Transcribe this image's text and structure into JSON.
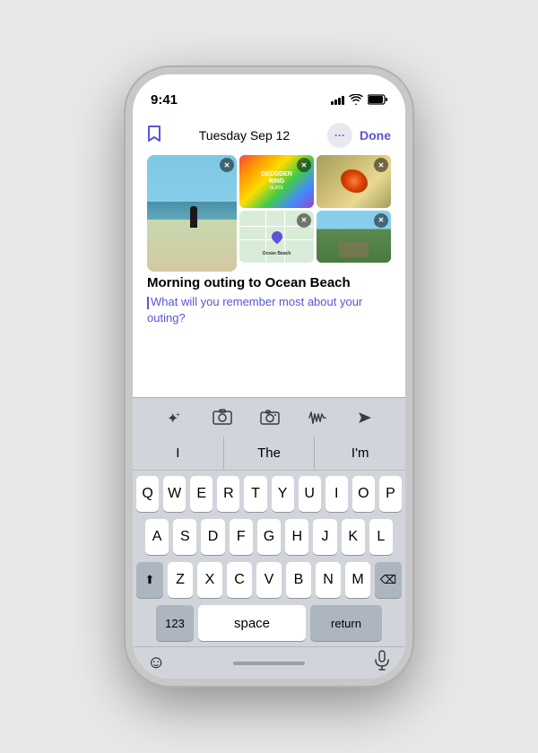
{
  "status": {
    "time": "9:41",
    "signal": [
      3,
      5,
      7,
      9,
      11
    ],
    "wifi": "WiFi",
    "battery": "Battery"
  },
  "header": {
    "date": "Tuesday Sep 12",
    "more_label": "···",
    "done_label": "Done"
  },
  "note": {
    "title": "Morning outing to Ocean Beach",
    "prompt": "What will you remember most about your outing?"
  },
  "toolbar": {
    "magic_label": "✦",
    "photo_label": "⊞",
    "camera_label": "⊙",
    "audio_label": "♒",
    "send_label": "➤"
  },
  "suggestions": {
    "items": [
      "I",
      "The",
      "I'm"
    ]
  },
  "keyboard": {
    "row1": [
      "Q",
      "W",
      "E",
      "R",
      "T",
      "Y",
      "U",
      "I",
      "O",
      "P"
    ],
    "row2": [
      "A",
      "S",
      "D",
      "F",
      "G",
      "H",
      "J",
      "K",
      "L"
    ],
    "row3": [
      "Z",
      "X",
      "C",
      "V",
      "B",
      "N",
      "M"
    ],
    "shift_label": "⬆",
    "delete_label": "⌫",
    "num_label": "123",
    "space_label": "space",
    "return_label": "return"
  },
  "bottom": {
    "emoji_label": "☺",
    "mic_label": "🎤"
  },
  "map": {
    "label": "Ocean Beach"
  }
}
